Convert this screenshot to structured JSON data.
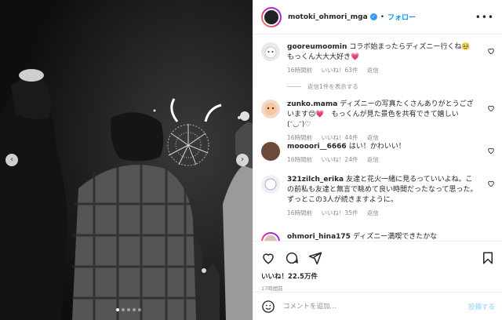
{
  "header": {
    "username": "motoki_ohmori_mga",
    "separator": "•",
    "follow_label": "フォロー",
    "more": "•••"
  },
  "replies_toggle": "返信1件を表示する",
  "comments": [
    {
      "username": "gooreumoomin",
      "text": "コラボ始まったらディズニー行くね🥹 もっくん大大大好き💗",
      "time": "16時間前",
      "likes": "いいね！63件",
      "reply": "返信"
    },
    {
      "username": "zunko.mama",
      "text": "ディズニーの写真たくさんありがとうございます😊💗　もっくんが見た景色を共有できて嬉しい(ᵔ◡ᵔ)♡",
      "time": "16時間前",
      "likes": "いいね！44件",
      "reply": "返信"
    },
    {
      "username": "moooori__6666",
      "text": "はい！かわいい！",
      "time": "16時間前",
      "likes": "いいね！24件",
      "reply": "返信"
    },
    {
      "username": "321zilch_erika",
      "text": "友達と花火一緒に見るっていいよね。この前私も友達と無言で眺めて良い時間だったなって思った。ずっとこの3人が続きますように。",
      "time": "16時間前",
      "likes": "いいね！35件",
      "reply": "返信"
    },
    {
      "username": "ohmori_hina175",
      "text": "ディズニー満喫できたかな",
      "time": "",
      "likes": "",
      "reply": ""
    }
  ],
  "likes_total": "いいね！22.5万件",
  "posted_ago": "17時間前",
  "add_comment": {
    "placeholder": "コメントを追加...",
    "post_label": "投稿する"
  },
  "carousel": {
    "slide_count": 5,
    "active_index": 0
  },
  "colors": {
    "accent": "#0095f6",
    "verified": "#3897f0",
    "heart": "#ed4956"
  },
  "icons": [
    "heart-icon",
    "comment-icon",
    "share-icon",
    "bookmark-icon",
    "emoji-icon",
    "chevron-left-icon",
    "chevron-right-icon",
    "more-icon",
    "verified-icon"
  ]
}
